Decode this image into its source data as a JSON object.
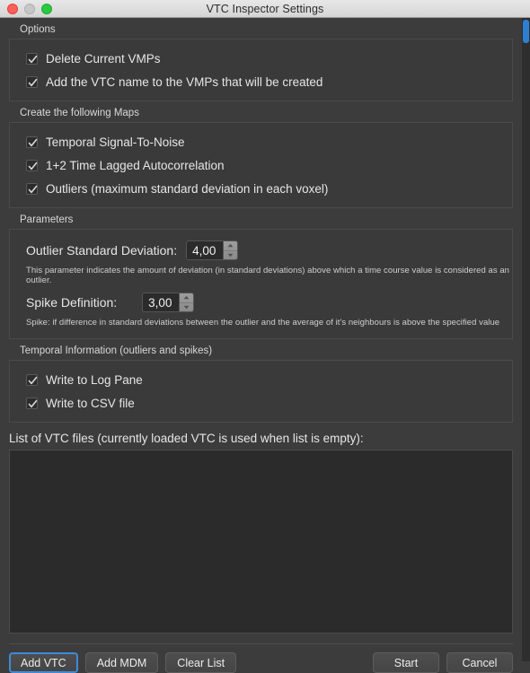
{
  "window": {
    "title": "VTC Inspector Settings",
    "controls": [
      {
        "name": "close",
        "color": "#ff5f57"
      },
      {
        "name": "minimize",
        "color": "#c7c7c7"
      },
      {
        "name": "maximize",
        "color": "#28c940"
      }
    ],
    "accent_color": "#3e8ad8",
    "background_color": "#3c3c3c"
  },
  "options_group": {
    "title": "Options",
    "items": [
      {
        "label": "Delete Current VMPs",
        "checked": true
      },
      {
        "label": "Add the VTC name to the VMPs that will be created",
        "checked": true
      }
    ]
  },
  "maps_group": {
    "title": "Create the following Maps",
    "items": [
      {
        "label": "Temporal Signal-To-Noise",
        "checked": true
      },
      {
        "label": "1+2 Time Lagged Autocorrelation",
        "checked": true
      },
      {
        "label": "Outliers (maximum standard deviation in each voxel)",
        "checked": true
      }
    ]
  },
  "parameters_group": {
    "title": "Parameters",
    "outlier": {
      "label": "Outlier Standard Deviation:",
      "value": "4,00",
      "help": "This parameter indicates the amount of deviation (in standard deviations) above which a time course value is considered as an outlier."
    },
    "spike": {
      "label": "Spike Definition:",
      "value": "3,00",
      "help": "Spike: if difference in standard deviations between the outlier and the average of it's neighbours  is above the specified value"
    }
  },
  "temporal_group": {
    "title": "Temporal Information (outliers and spikes)",
    "items": [
      {
        "label": "Write to Log Pane",
        "checked": true
      },
      {
        "label": "Write to CSV file",
        "checked": true
      }
    ]
  },
  "file_list": {
    "label": "List of VTC files (currently loaded VTC is used when list is empty):",
    "items": []
  },
  "buttons": {
    "add_vtc": "Add VTC",
    "add_mdm": "Add MDM",
    "clear_list": "Clear List",
    "start": "Start",
    "cancel": "Cancel"
  }
}
